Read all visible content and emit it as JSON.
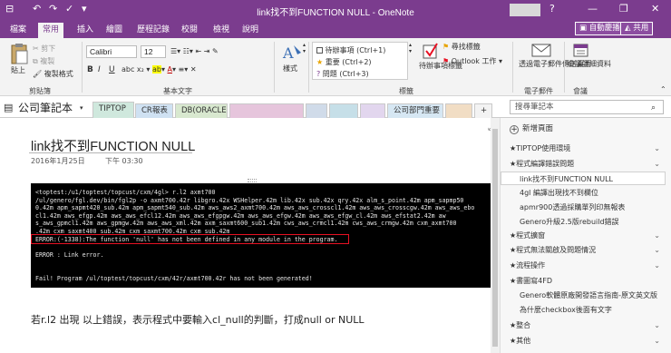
{
  "window": {
    "title": "link找不到FUNCTION NULL  -  OneNote",
    "help": "?",
    "minimize": "—",
    "restore": "❐",
    "close": "✕"
  },
  "quick_access": [
    "⊟",
    "↶",
    "↷",
    "✓",
    "▾"
  ],
  "ribbon_tabs": [
    "檔案",
    "常用",
    "插入",
    "繪圖",
    "歷程記錄",
    "校閱",
    "檢視",
    "說明"
  ],
  "active_tab": "常用",
  "top_buttons": {
    "auto_sync": "自動慶播",
    "share": "共用"
  },
  "clipboard": {
    "paste": "貼上",
    "cut": "剪下",
    "copy": "複製",
    "format_painter": "複製格式",
    "label": "剪貼簿"
  },
  "basic_text": {
    "font": "Calibri",
    "size": "12",
    "label": "基本文字",
    "bold": "B",
    "italic": "I",
    "underline": "U"
  },
  "styles": {
    "label": "樣式"
  },
  "tags": {
    "items": [
      "待辦事項 (Ctrl+1)",
      "重要 (Ctrl+2)",
      "問題 (Ctrl+3)"
    ],
    "todo_tag": "待辦事項標籤",
    "find_tags": "尋找標籤",
    "outlook_tasks": "Outlook 工作",
    "label": "標籤"
  },
  "email": {
    "button": "透過電子郵件傳送頁面",
    "label": "電子郵件"
  },
  "meeting": {
    "button": "會議詳細資料",
    "label": "會議"
  },
  "notebook": {
    "name": "公司筆記本"
  },
  "section_tabs": [
    "TIPTOP",
    "CR報表",
    "DB(ORACLE",
    "",
    "",
    "",
    "",
    "公司部門重要",
    "",
    "+"
  ],
  "search": {
    "placeholder": "搜尋筆記本"
  },
  "page": {
    "title": "link找不到FUNCTION NULL",
    "date": "2016年1月25日",
    "time": "下午 03:30",
    "terminal": [
      " <toptest:/u1/toptest/topcust/cxm/4gl> r.l2 axmt700",
      "/ul/genero/fgl.dev/bin/fgl2p -o axmt700.42r  libgro.42x WSHelper.42m lib.42x sub.42x qry.42x  alm_s_point.42m apm_sapmp50",
      "0.42m apm_sapmt420_sub.42m apm_sapmt540_sub.42m aws_aws2_axmt700.42m aws_aws_crosscl1.42m aws_aws_crosscgw.42m aws_aws_ebo",
      "cl1.42m aws_efgp.42m aws_aws_efcl12.42m aws_aws_efgpgw.42m aws_aws_efgw.42m aws_aws_efgw_cl.42m aws_efstat2.42m aw",
      "s_aws_gpmcl1.42m aws_gpmgw.42m aws_aws_xml.42m axm_saxmt600_sub1.42m cws_aws_crmcl1.42m cws_aws_crmgw.42m cxm_axmt700",
      ".42m cxm_saxmt400_sub.42m cxm_saxmt700.42m cxm_sub.42m",
      "ERROR:(-1338):The function 'null' has not been defined in any module in the program.",
      "",
      "ERROR : Link error.",
      "",
      "",
      "Fail! Program /ul/toptest/topcust/cxm/42r/axmt700.42r  has not been generated!"
    ],
    "note": "若r.l2 出現 以上錯誤，表示程式中要輸入cl_null的判斷，打成null or NULL"
  },
  "pages_panel": {
    "add_page": "新增頁面",
    "items": [
      {
        "label": "★TIPTOP使用環境",
        "level": 0,
        "collapsible": true
      },
      {
        "label": "★程式編譯錯誤問題",
        "level": 0,
        "collapsible": true
      },
      {
        "label": "link找不到FUNCTION NULL",
        "level": 1,
        "selected": true
      },
      {
        "label": "4gl 編譯出現找不到欄位",
        "level": 1
      },
      {
        "label": "apmr900透過採購單列印無報表",
        "level": 1
      },
      {
        "label": "Genero升級2.5版rebuild錯誤",
        "level": 1
      },
      {
        "label": "★程式擴窗",
        "level": 0,
        "collapsible": true
      },
      {
        "label": "★程式無法關啟及問題情況",
        "level": 0,
        "collapsible": true
      },
      {
        "label": "★流程操作",
        "level": 0,
        "collapsible": true
      },
      {
        "label": "★書圖寫4FD",
        "level": 0,
        "collapsible": false
      },
      {
        "label": "Genero軟體原廠開發語言指南-原文英文版",
        "level": 1
      },
      {
        "label": "為什麼checkbox後面有文字",
        "level": 1
      },
      {
        "label": "★整合",
        "level": 0,
        "collapsible": true
      },
      {
        "label": "★其他",
        "level": 0,
        "collapsible": true
      }
    ]
  },
  "colors": {
    "brand": "#7b3c8e",
    "error_box": "#e81123",
    "terminal_bg": "#000000"
  }
}
